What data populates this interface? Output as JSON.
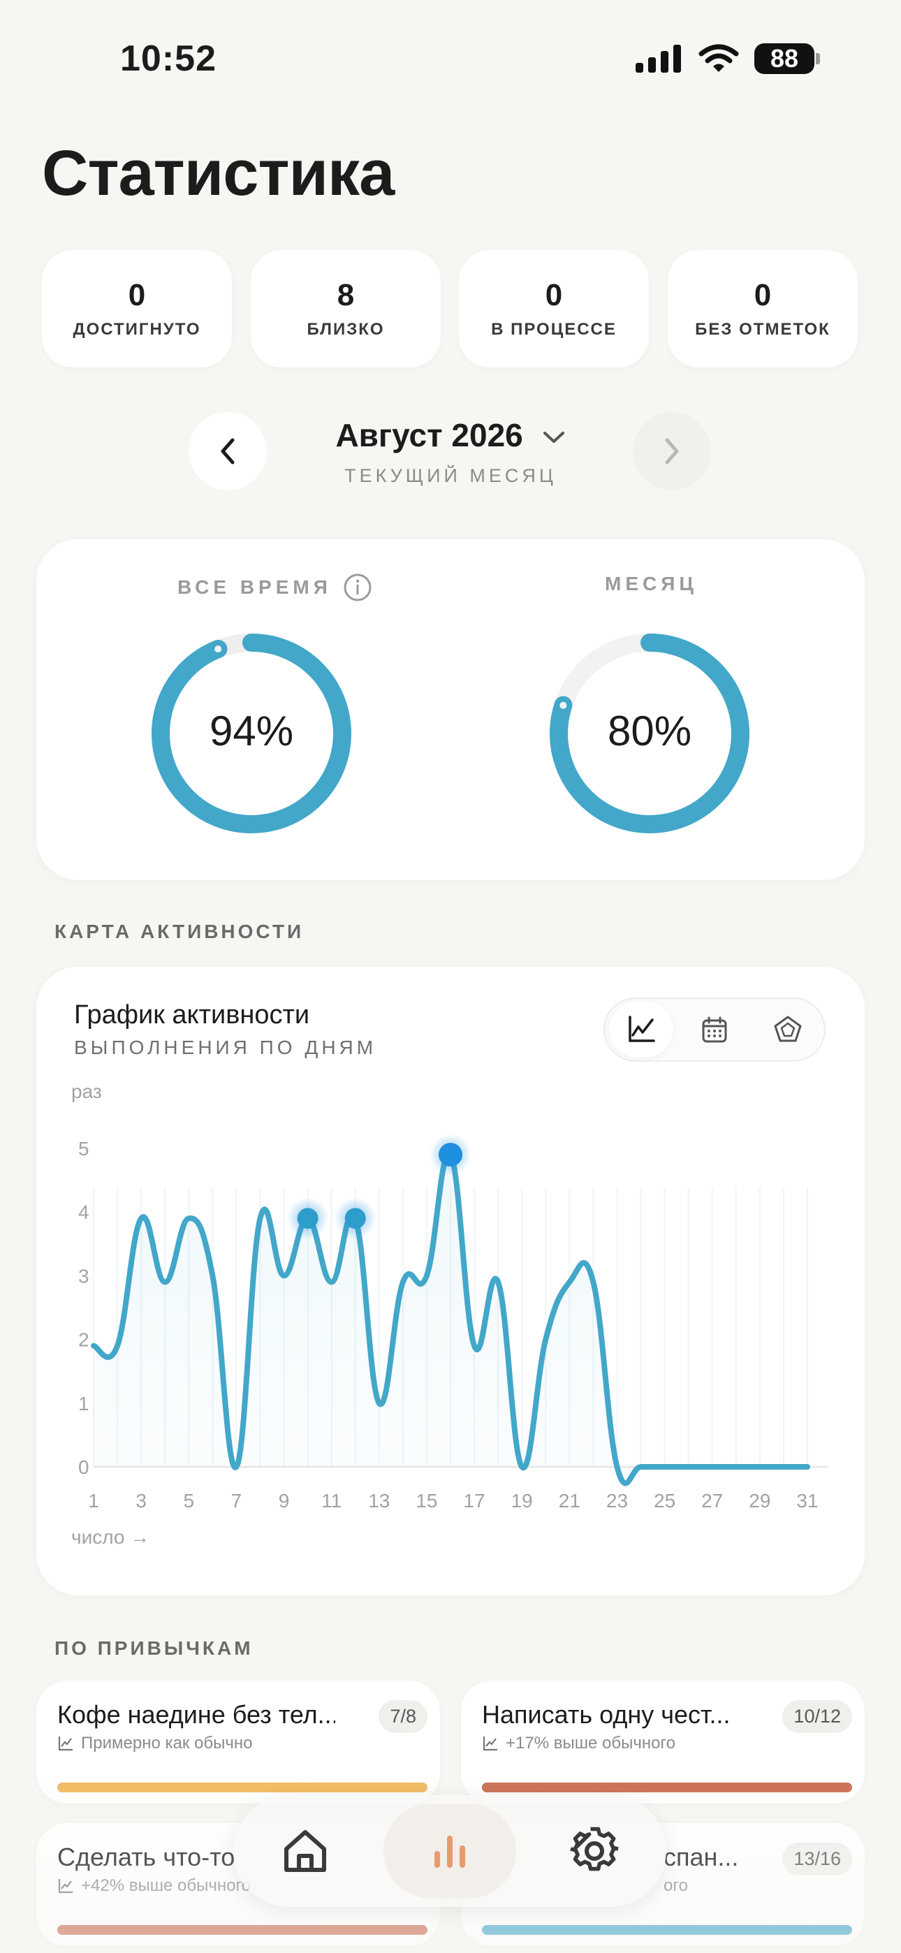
{
  "status_bar": {
    "time": "10:52",
    "battery": "88"
  },
  "page_title": "Статистика",
  "stats": [
    {
      "value": "0",
      "label": "ДОСТИГНУТО"
    },
    {
      "value": "8",
      "label": "БЛИЗКО"
    },
    {
      "value": "0",
      "label": "В ПРОЦЕССЕ"
    },
    {
      "value": "0",
      "label": "БЕЗ ОТМЕТОК"
    }
  ],
  "month_nav": {
    "title": "Август 2026",
    "subtitle": "ТЕКУЩИЙ МЕСЯЦ"
  },
  "rings": {
    "all_time": {
      "label": "ВСЕ ВРЕМЯ",
      "value_text": "94%",
      "fraction": 0.94
    },
    "month": {
      "label": "МЕСЯЦ",
      "value_text": "80%",
      "fraction": 0.8
    }
  },
  "colors": {
    "accent": "#42a7c9",
    "yellow": "#f0b85a",
    "terracotta": "#c96a4e",
    "glow": "#1f8fe0"
  },
  "sections": {
    "activity_map": "КАРТА АКТИВНОСТИ",
    "by_habits": "ПО ПРИВЫЧКАМ"
  },
  "chart": {
    "title": "График активности",
    "subtitle": "ВЫПОЛНЕНИЯ ПО ДНЯМ",
    "views": [
      "line-chart-icon",
      "calendar-icon",
      "pentagon-icon"
    ]
  },
  "chart_data": {
    "type": "line",
    "ylabel": "раз",
    "xlabel": "число →",
    "ylim": [
      0,
      5
    ],
    "yticks": [
      0,
      1,
      2,
      3,
      4,
      5
    ],
    "xticks": [
      1,
      3,
      5,
      7,
      9,
      11,
      13,
      15,
      17,
      19,
      21,
      23,
      25,
      27,
      29,
      31
    ],
    "x": [
      1,
      2,
      3,
      4,
      5,
      6,
      7,
      8,
      9,
      10,
      11,
      12,
      13,
      14,
      15,
      16,
      17,
      18,
      19,
      20,
      21,
      22,
      23,
      24,
      25,
      26,
      27,
      28,
      29,
      30,
      31
    ],
    "values": [
      1.9,
      1.9,
      3.9,
      2.9,
      3.9,
      3.0,
      0,
      3.9,
      3.0,
      3.9,
      2.9,
      3.9,
      1.0,
      2.9,
      3.0,
      4.9,
      1.9,
      2.9,
      0,
      2.0,
      2.9,
      2.9,
      0,
      0,
      0,
      0,
      0,
      0,
      0,
      0,
      0
    ],
    "highlighted_x": [
      10,
      12,
      16
    ]
  },
  "habits": [
    {
      "name": "Кофе наедине без тел...",
      "trend": "Примерно как обычно",
      "badge": "7/8",
      "progress": 0.875,
      "color": "#f0b85a"
    },
    {
      "name": "Написать одну чест...",
      "trend": "+17% выше обычного",
      "badge": "10/12",
      "progress": 0.83,
      "color": "#c96a4e"
    },
    {
      "name": "Сделать что-то",
      "trend": "+42% выше обычного",
      "badge": "",
      "progress": 0.9,
      "color": "#c96a4e"
    },
    {
      "name": "спан...",
      "trend": "ого",
      "badge": "13/16",
      "progress": 0.81,
      "color": "#42a7c9"
    }
  ],
  "tab_bar": {
    "items": [
      "home-icon",
      "stats-icon",
      "settings-icon"
    ],
    "active": "stats-icon"
  }
}
